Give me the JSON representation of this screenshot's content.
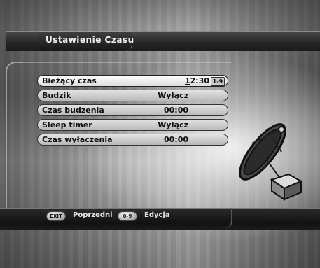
{
  "screen": {
    "title": "Ustawienie Czasu"
  },
  "menu": {
    "items": [
      {
        "label": "Bieżący czas",
        "value_cursor": "1",
        "value_rest": "2:30",
        "badge": "1-9",
        "selected": true
      },
      {
        "label": "Budzik",
        "value": "Wyłącz"
      },
      {
        "label": "Czas budzenia",
        "value": "00:00"
      },
      {
        "label": "Sleep timer",
        "value": "Wyłącz"
      },
      {
        "label": "Czas wyłączenia",
        "value": "00:00"
      }
    ]
  },
  "footer": {
    "exit_key": "EXIT",
    "exit_label": "Poprzedni",
    "digits_key": "0-9",
    "digits_label": "Edycja"
  },
  "colors": {
    "selected_row": "#ffffff",
    "row": "#c4c4c4",
    "bar": "#1b1b1b"
  },
  "icons": {
    "decoration": "satellite-dish-icon"
  }
}
